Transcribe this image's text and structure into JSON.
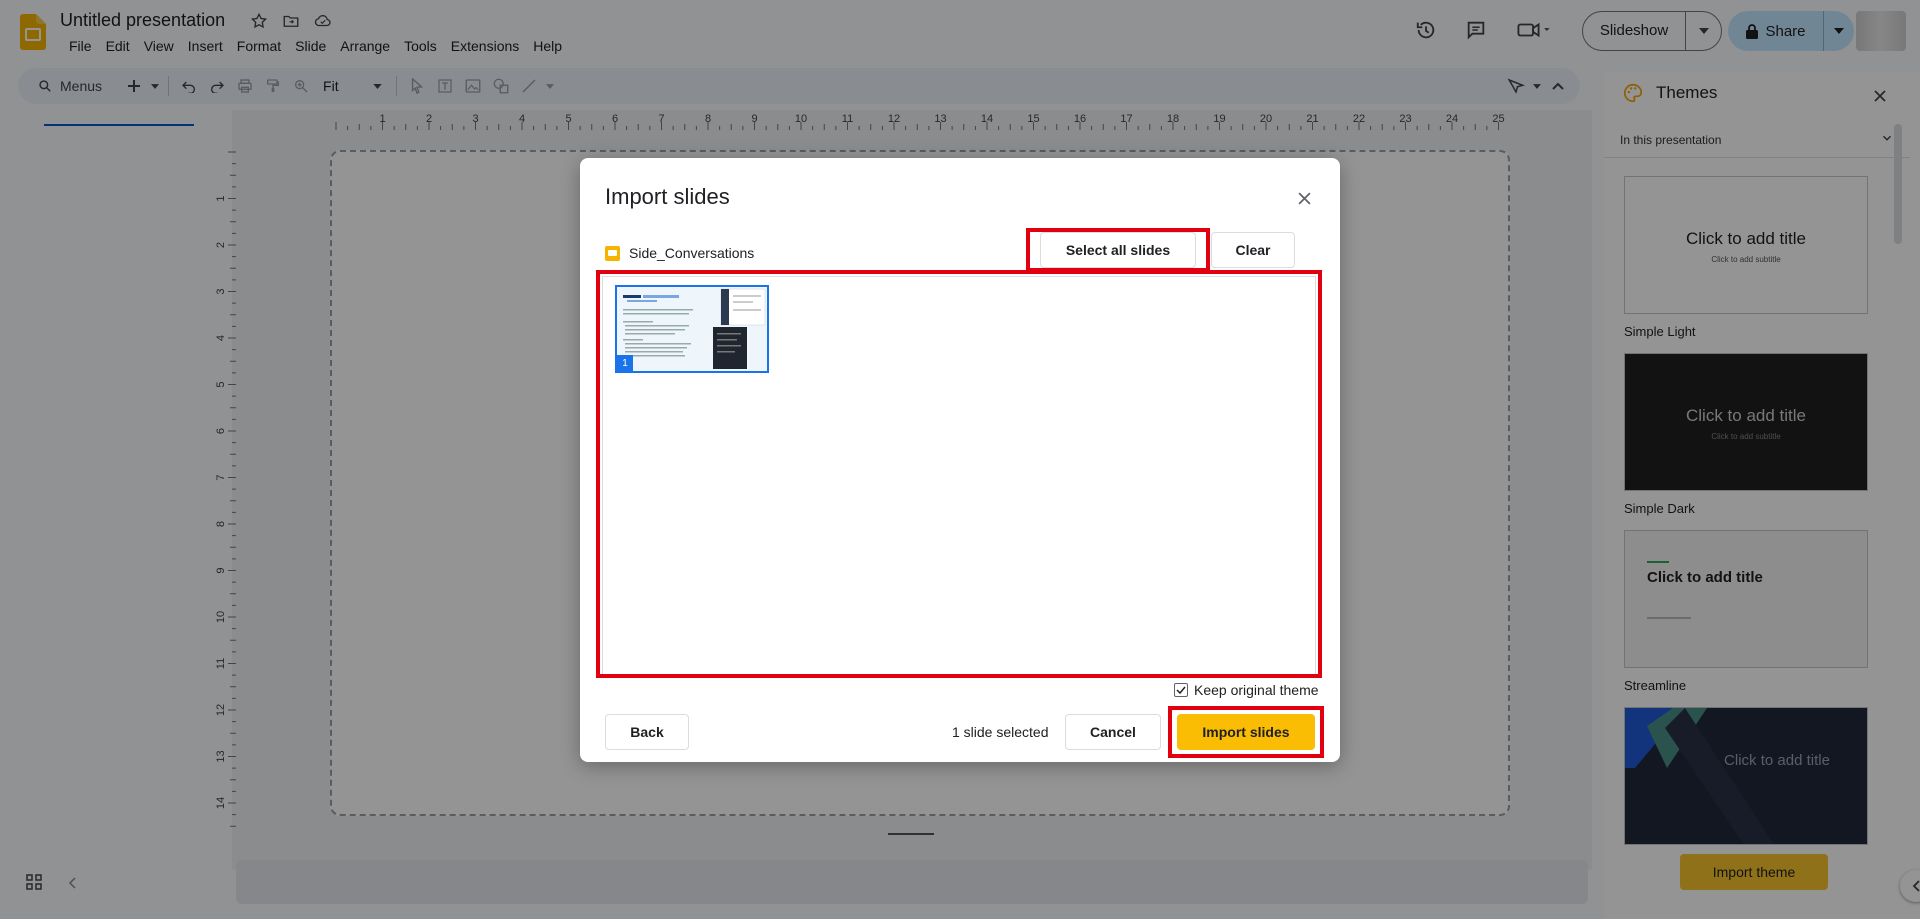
{
  "header": {
    "doc_title": "Untitled presentation",
    "menu": [
      "File",
      "Edit",
      "View",
      "Insert",
      "Format",
      "Slide",
      "Arrange",
      "Tools",
      "Extensions",
      "Help"
    ],
    "slideshow_label": "Slideshow",
    "share_label": "Share"
  },
  "toolbar": {
    "search_label": "Menus",
    "zoom_label": "Fit"
  },
  "ruler": {
    "h_ticks": [
      "1",
      "2",
      "3",
      "4",
      "5",
      "6",
      "7",
      "8",
      "9",
      "10",
      "11",
      "12",
      "13",
      "14",
      "15",
      "16",
      "17",
      "18",
      "19",
      "20",
      "21",
      "22",
      "23",
      "24",
      "25"
    ],
    "v_ticks": [
      "1",
      "2",
      "3",
      "4",
      "5",
      "6",
      "7",
      "8",
      "9",
      "10",
      "11",
      "12",
      "13",
      "14"
    ]
  },
  "themes": {
    "title": "Themes",
    "filter": "In this presentation",
    "items": [
      {
        "name": "Simple Light",
        "title": "Click to add title",
        "subtitle": "Click to add subtitle"
      },
      {
        "name": "Simple Dark",
        "title": "Click to add title",
        "subtitle": "Click to add subtitle"
      },
      {
        "name": "Streamline",
        "title": "Click to add title",
        "subtitle": ""
      },
      {
        "name": "",
        "title": "Click to add title",
        "subtitle": ""
      }
    ],
    "import_label": "Import theme"
  },
  "dialog": {
    "title": "Import slides",
    "source_name": "Side_Conversations",
    "select_all_label": "Select all slides",
    "clear_label": "Clear",
    "slide_number": "1",
    "keep_theme_label": "Keep original theme",
    "back_label": "Back",
    "selection_count": "1 slide selected",
    "cancel_label": "Cancel",
    "import_label": "Import slides"
  },
  "colors": {
    "accent_yellow": "#fbbc04",
    "highlight_red": "#e00010",
    "share_blue": "#c2e7ff",
    "selection_blue": "#1a73e8"
  }
}
